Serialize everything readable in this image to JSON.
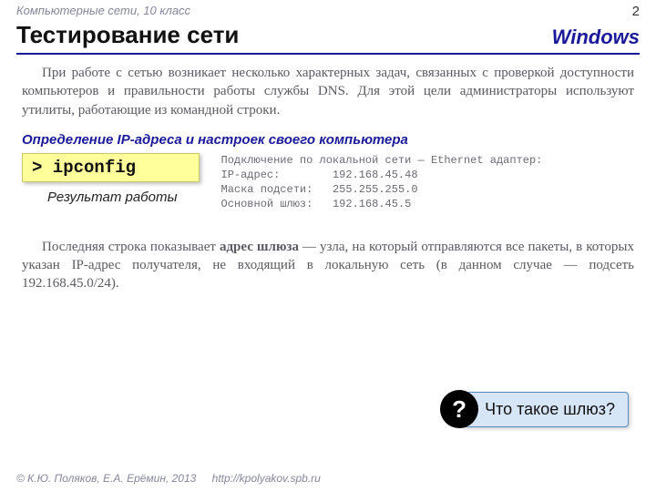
{
  "header": {
    "course": "Компьютерные сети, 10 класс",
    "page_number": "2"
  },
  "title": "Тестирование сети",
  "os": "Windows",
  "intro": "При работе с сетью возникает несколько характерных задач, связанных с проверкой доступности компьютеров и правильности работы службы DNS. Для этой цели администраторы используют утилиты, работающие из командной строки.",
  "subheading": "Определение IP-адреса и настроек своего компьютера",
  "command": "> ipconfig",
  "result_label": "Результат работы",
  "output": {
    "line1": "Подключение по локальной сети — Ethernet адаптер:",
    "kv": [
      {
        "k": "IP-адрес:",
        "v": "192.168.45.48"
      },
      {
        "k": "Маска подсети:",
        "v": "255.255.255.0"
      },
      {
        "k": "Основной шлюз:",
        "v": "192.168.45.5"
      }
    ]
  },
  "para2_pre": "Последняя строка показывает ",
  "para2_bold": "адрес шлюза",
  "para2_post": " — узла, на который отправляются все пакеты, в которых указан IP-адрес получателя, не входящий в локальную сеть (в данном случае — подсеть 192.168.45.0/24).",
  "callout": {
    "icon": "?",
    "text": "Что такое шлюз?"
  },
  "footer": {
    "authors": "© К.Ю. Поляков, Е.А. Ерёмин, 2013",
    "url": "http://kpolyakov.spb.ru"
  }
}
